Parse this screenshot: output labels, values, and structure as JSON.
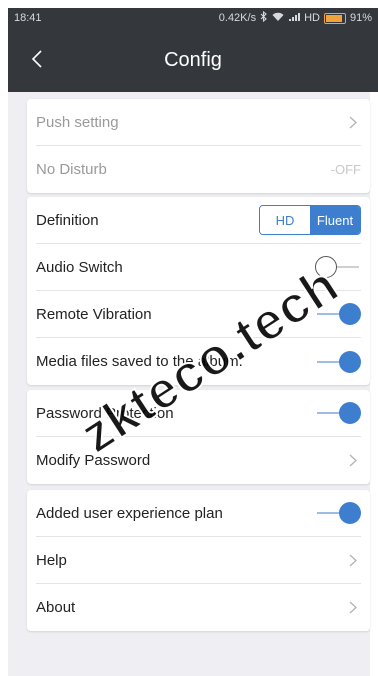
{
  "status_bar": {
    "time": "18:41",
    "network_speed": "0.42K/s",
    "network": "HD",
    "battery": "91%",
    "icons": [
      "bluetooth-icon",
      "wifi-icon",
      "signal-icon",
      "battery-icon"
    ]
  },
  "header": {
    "title": "Config",
    "back_icon": "chevron-left-icon"
  },
  "groups": [
    {
      "rows": [
        {
          "label": "Push setting",
          "control": "chevron",
          "disabled": true
        },
        {
          "label": "No Disturb",
          "control": "text",
          "value": "-OFF",
          "disabled": true
        }
      ]
    },
    {
      "rows": [
        {
          "label": "Definition",
          "control": "segmented",
          "options": [
            "HD",
            "Fluent"
          ],
          "selected": "Fluent"
        },
        {
          "label": "Audio Switch",
          "control": "toggle",
          "on": false
        },
        {
          "label": "Remote Vibration",
          "control": "toggle",
          "on": true
        },
        {
          "label": "Media files saved to the album.",
          "control": "toggle",
          "on": true
        }
      ]
    },
    {
      "rows": [
        {
          "label": "Password Protection",
          "control": "toggle",
          "on": true
        },
        {
          "label": "Modify Password",
          "control": "chevron"
        }
      ]
    },
    {
      "rows": [
        {
          "label": "Added user experience plan",
          "control": "toggle",
          "on": true
        },
        {
          "label": "Help",
          "control": "chevron"
        },
        {
          "label": "About",
          "control": "chevron"
        }
      ]
    }
  ],
  "watermark": "zkteco.tech",
  "colors": {
    "accent": "#3d7fce",
    "header_bg": "#34373c",
    "page_bg": "#efeff3"
  }
}
